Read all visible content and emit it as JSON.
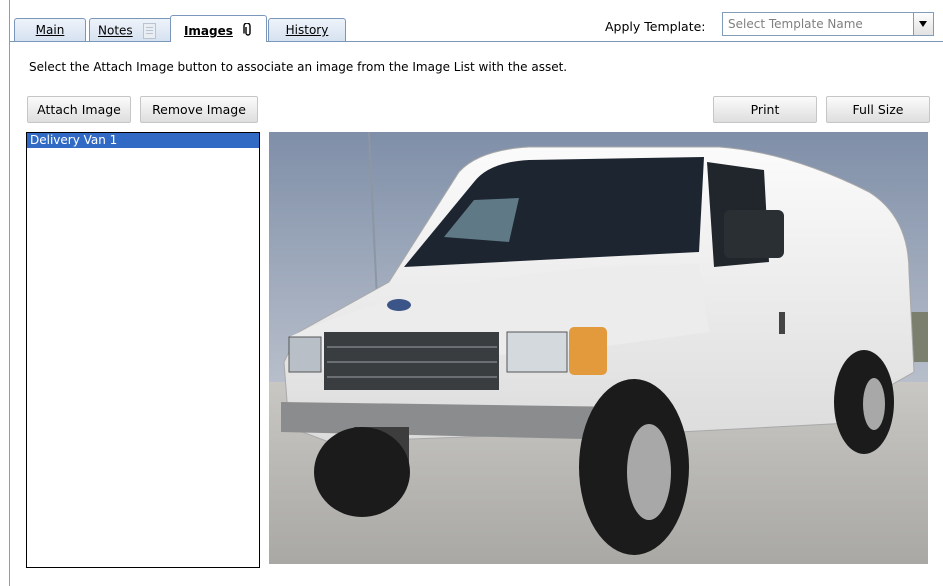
{
  "tabs": [
    {
      "label": "Main",
      "icon": null,
      "active": false
    },
    {
      "label": "Notes",
      "icon": "notes-icon",
      "active": false
    },
    {
      "label": "Images",
      "icon": "paperclip-icon",
      "active": true
    },
    {
      "label": "History",
      "icon": null,
      "active": false
    }
  ],
  "template": {
    "label": "Apply Template:",
    "placeholder": "Select Template Name"
  },
  "instructions": "Select the Attach Image button to associate an image from the Image List with the asset.",
  "buttons": {
    "attach": "Attach Image",
    "remove": "Remove Image",
    "print": "Print",
    "full_size": "Full Size"
  },
  "image_list": {
    "items": [
      "Delivery Van 1"
    ],
    "selected_index": 0
  },
  "preview": {
    "subject": "white delivery van",
    "colors": {
      "sky": "#9aa6b8",
      "van_body": "#f2f2f2",
      "ground": "#bdbcb8"
    }
  },
  "colors": {
    "selection": "#316ac5",
    "tab_border": "#7a96b8"
  }
}
